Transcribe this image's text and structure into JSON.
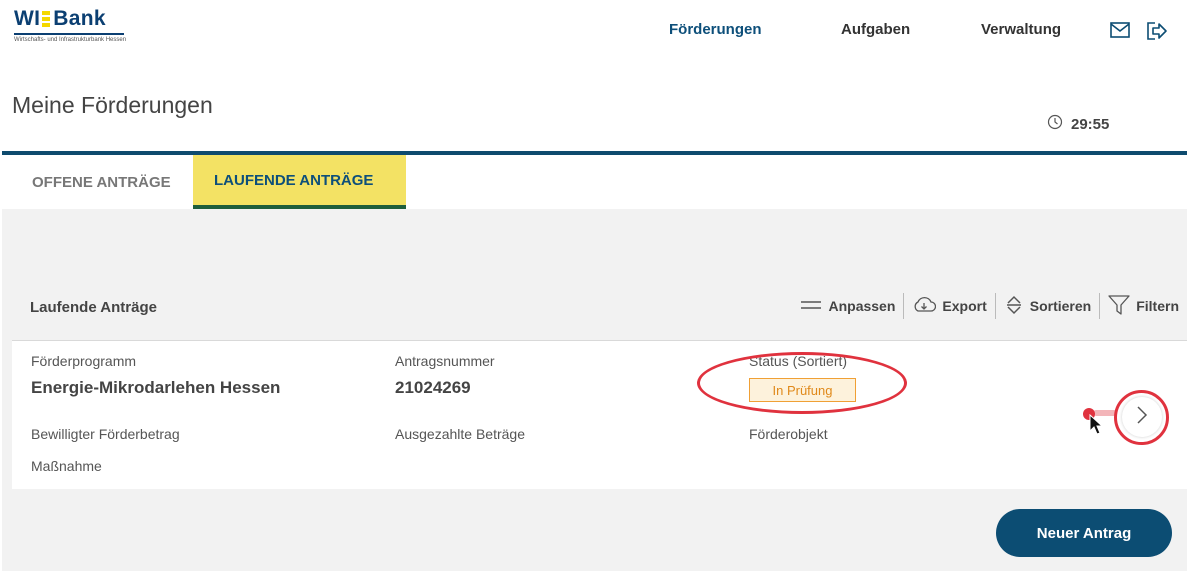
{
  "logo": {
    "text_left": "WI",
    "text_right": "Bank",
    "subtitle": "Wirtschafts- und Infrastrukturbank Hessen"
  },
  "nav": {
    "foerderungen": "Förderungen",
    "aufgaben": "Aufgaben",
    "verwaltung": "Verwaltung"
  },
  "page": {
    "title": "Meine Förderungen",
    "timer": "29:55"
  },
  "tabs": [
    {
      "label": "OFFENE ANTRÄGE"
    },
    {
      "label": "LAUFENDE ANTRÄGE"
    }
  ],
  "card": {
    "title": "Laufende Anträge",
    "toolbar": {
      "anpassen": "Anpassen",
      "export": "Export",
      "sortieren": "Sortieren",
      "filtern": "Filtern"
    },
    "fields": {
      "programm_label": "Förderprogramm",
      "programm_value": "Energie-Mikrodarlehen Hessen",
      "antragsnummer_label": "Antragsnummer",
      "antragsnummer_value": "21024269",
      "status_label": "Status (Sortiert)",
      "status_value": "In Prüfung",
      "betrag_label": "Bewilligter Förderbetrag",
      "ausgezahlt_label": "Ausgezahlte Beträge",
      "objekt_label": "Förderobjekt",
      "massnahme_label": "Maßnahme"
    }
  },
  "button": {
    "neuer_antrag": "Neuer Antrag"
  },
  "colors": {
    "brand_blue": "#0c4d73",
    "tab_active": "#f3e264",
    "status_orange": "#f0a035",
    "annotation_red": "#e0323e"
  }
}
